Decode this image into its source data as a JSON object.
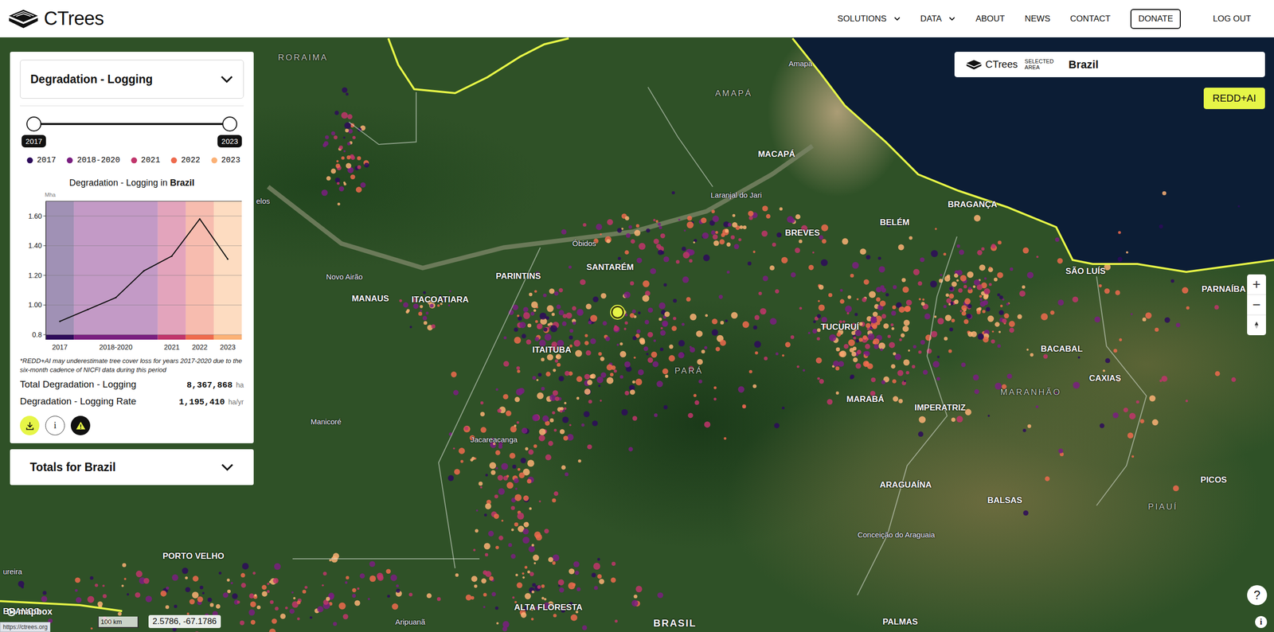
{
  "header": {
    "logo": "CTrees",
    "nav": [
      {
        "label": "SOLUTIONS",
        "kind": "menu",
        "dropdown": true
      },
      {
        "label": "DATA",
        "kind": "menu",
        "dropdown": true
      },
      {
        "label": "ABOUT",
        "kind": "link",
        "dropdown": false
      },
      {
        "label": "NEWS",
        "kind": "link",
        "dropdown": false
      },
      {
        "label": "CONTACT",
        "kind": "link",
        "dropdown": false
      },
      {
        "label": "DONATE",
        "kind": "button",
        "dropdown": false
      },
      {
        "label": "LOG OUT",
        "kind": "link",
        "dropdown": false
      }
    ]
  },
  "panel": {
    "layer": "Degradation - Logging",
    "expanded": false,
    "range": {
      "start": "2017",
      "end": "2023",
      "low": 0,
      "high": 1
    },
    "legend": [
      {
        "label": "2017",
        "color": "#2d0b5a"
      },
      {
        "label": "2018-2020",
        "color": "#7a1f80"
      },
      {
        "label": "2021",
        "color": "#c0356b"
      },
      {
        "label": "2022",
        "color": "#ee6a4d"
      },
      {
        "label": "2023",
        "color": "#fbb176"
      }
    ],
    "chart": {
      "title": "Degradation - Logging in",
      "area": "Brazil",
      "unit": "Mha",
      "y_ticks": [
        "1.60",
        "1.40",
        "1.20",
        "1.00",
        "0.8"
      ],
      "bands": [
        {
          "label": "2017",
          "color": "#2d0b5a",
          "points": 1
        },
        {
          "label": "2018-2020",
          "color": "#7a1f80",
          "points": 3
        },
        {
          "label": "2021",
          "color": "#c0356b",
          "points": 1
        },
        {
          "label": "2022",
          "color": "#ee6a4d",
          "points": 1
        },
        {
          "label": "2023",
          "color": "#fbb176",
          "points": 1
        }
      ],
      "values": [
        0.89,
        0.97,
        1.05,
        1.23,
        1.33,
        1.58,
        1.31
      ]
    },
    "footnote": "*REDD+AI may underestimate tree cover loss for years 2017-2020 due to the six-month cadence of NICFI data during this period",
    "stats": [
      {
        "label": "Total Degradation - Logging",
        "value": "8,367,868",
        "unit": "ha"
      },
      {
        "label": "Degradation - Logging Rate",
        "value": "1,195,410",
        "unit": "ha/yr"
      }
    ],
    "actions": [
      {
        "kind": "download",
        "label": ""
      },
      {
        "kind": "info",
        "label": "i"
      },
      {
        "kind": "warning",
        "label": ""
      }
    ]
  },
  "totals": {
    "title": "Totals for Brazil",
    "expanded": false
  },
  "selected_area": {
    "brand": "CTrees",
    "caption": "SELECTED AREA",
    "value": "Brazil"
  },
  "redd_button": "REDD+AI",
  "zoom": [
    "+",
    "−"
  ],
  "map": {
    "labels": [
      {
        "text": "RORAIMA",
        "kind": "state"
      },
      {
        "text": "Amapá",
        "kind": "town"
      },
      {
        "text": "AMAPÁ",
        "kind": "state"
      },
      {
        "text": "MACAPÁ",
        "kind": "city"
      },
      {
        "text": "Laranjal do Jari",
        "kind": "town"
      },
      {
        "text": "BRAGANÇA",
        "kind": "city"
      },
      {
        "text": "BELÉM",
        "kind": "city"
      },
      {
        "text": "BREVES",
        "kind": "city"
      },
      {
        "text": "Óbidos",
        "kind": "town"
      },
      {
        "text": "SANTARÉM",
        "kind": "city"
      },
      {
        "text": "PARINTINS",
        "kind": "city"
      },
      {
        "text": "Novo Airão",
        "kind": "town"
      },
      {
        "text": "MANAUS",
        "kind": "city"
      },
      {
        "text": "ITACOATIARA",
        "kind": "city"
      },
      {
        "text": "SÃO LUÍS",
        "kind": "city"
      },
      {
        "text": "PARNAÍBA",
        "kind": "city"
      },
      {
        "text": "TUCURUÍ",
        "kind": "city"
      },
      {
        "text": "ITAITUBA",
        "kind": "city"
      },
      {
        "text": "BACABAL",
        "kind": "city"
      },
      {
        "text": "PARÁ",
        "kind": "state"
      },
      {
        "text": "CAXIAS",
        "kind": "city"
      },
      {
        "text": "MARANHÃO",
        "kind": "state"
      },
      {
        "text": "MARABÁ",
        "kind": "city"
      },
      {
        "text": "IMPERATRIZ",
        "kind": "city"
      },
      {
        "text": "Manicoré",
        "kind": "town"
      },
      {
        "text": "Jacareacanga",
        "kind": "town"
      },
      {
        "text": "PICOS",
        "kind": "city"
      },
      {
        "text": "ARAGUAÍNA",
        "kind": "city"
      },
      {
        "text": "BALSAS",
        "kind": "city"
      },
      {
        "text": "PIAUÍ",
        "kind": "state"
      },
      {
        "text": "Conceição do Araguaia",
        "kind": "town"
      },
      {
        "text": "PORTO VELHO",
        "kind": "city"
      },
      {
        "text": "ALTA FLORESTA",
        "kind": "city"
      },
      {
        "text": "PALMAS",
        "kind": "city"
      },
      {
        "text": "Aripuanã",
        "kind": "town"
      },
      {
        "text": "BRASIL",
        "kind": "country"
      },
      {
        "text": "elos",
        "kind": "town"
      },
      {
        "text": "ureira",
        "kind": "town"
      },
      {
        "text": "BRANCO",
        "kind": "city"
      }
    ]
  },
  "footer": {
    "attribution": "mapbox",
    "scale": "100 km",
    "coordinates": "2.5786, -67.1786",
    "help": "?",
    "info": "i",
    "status_url": "https://ctrees.org"
  }
}
